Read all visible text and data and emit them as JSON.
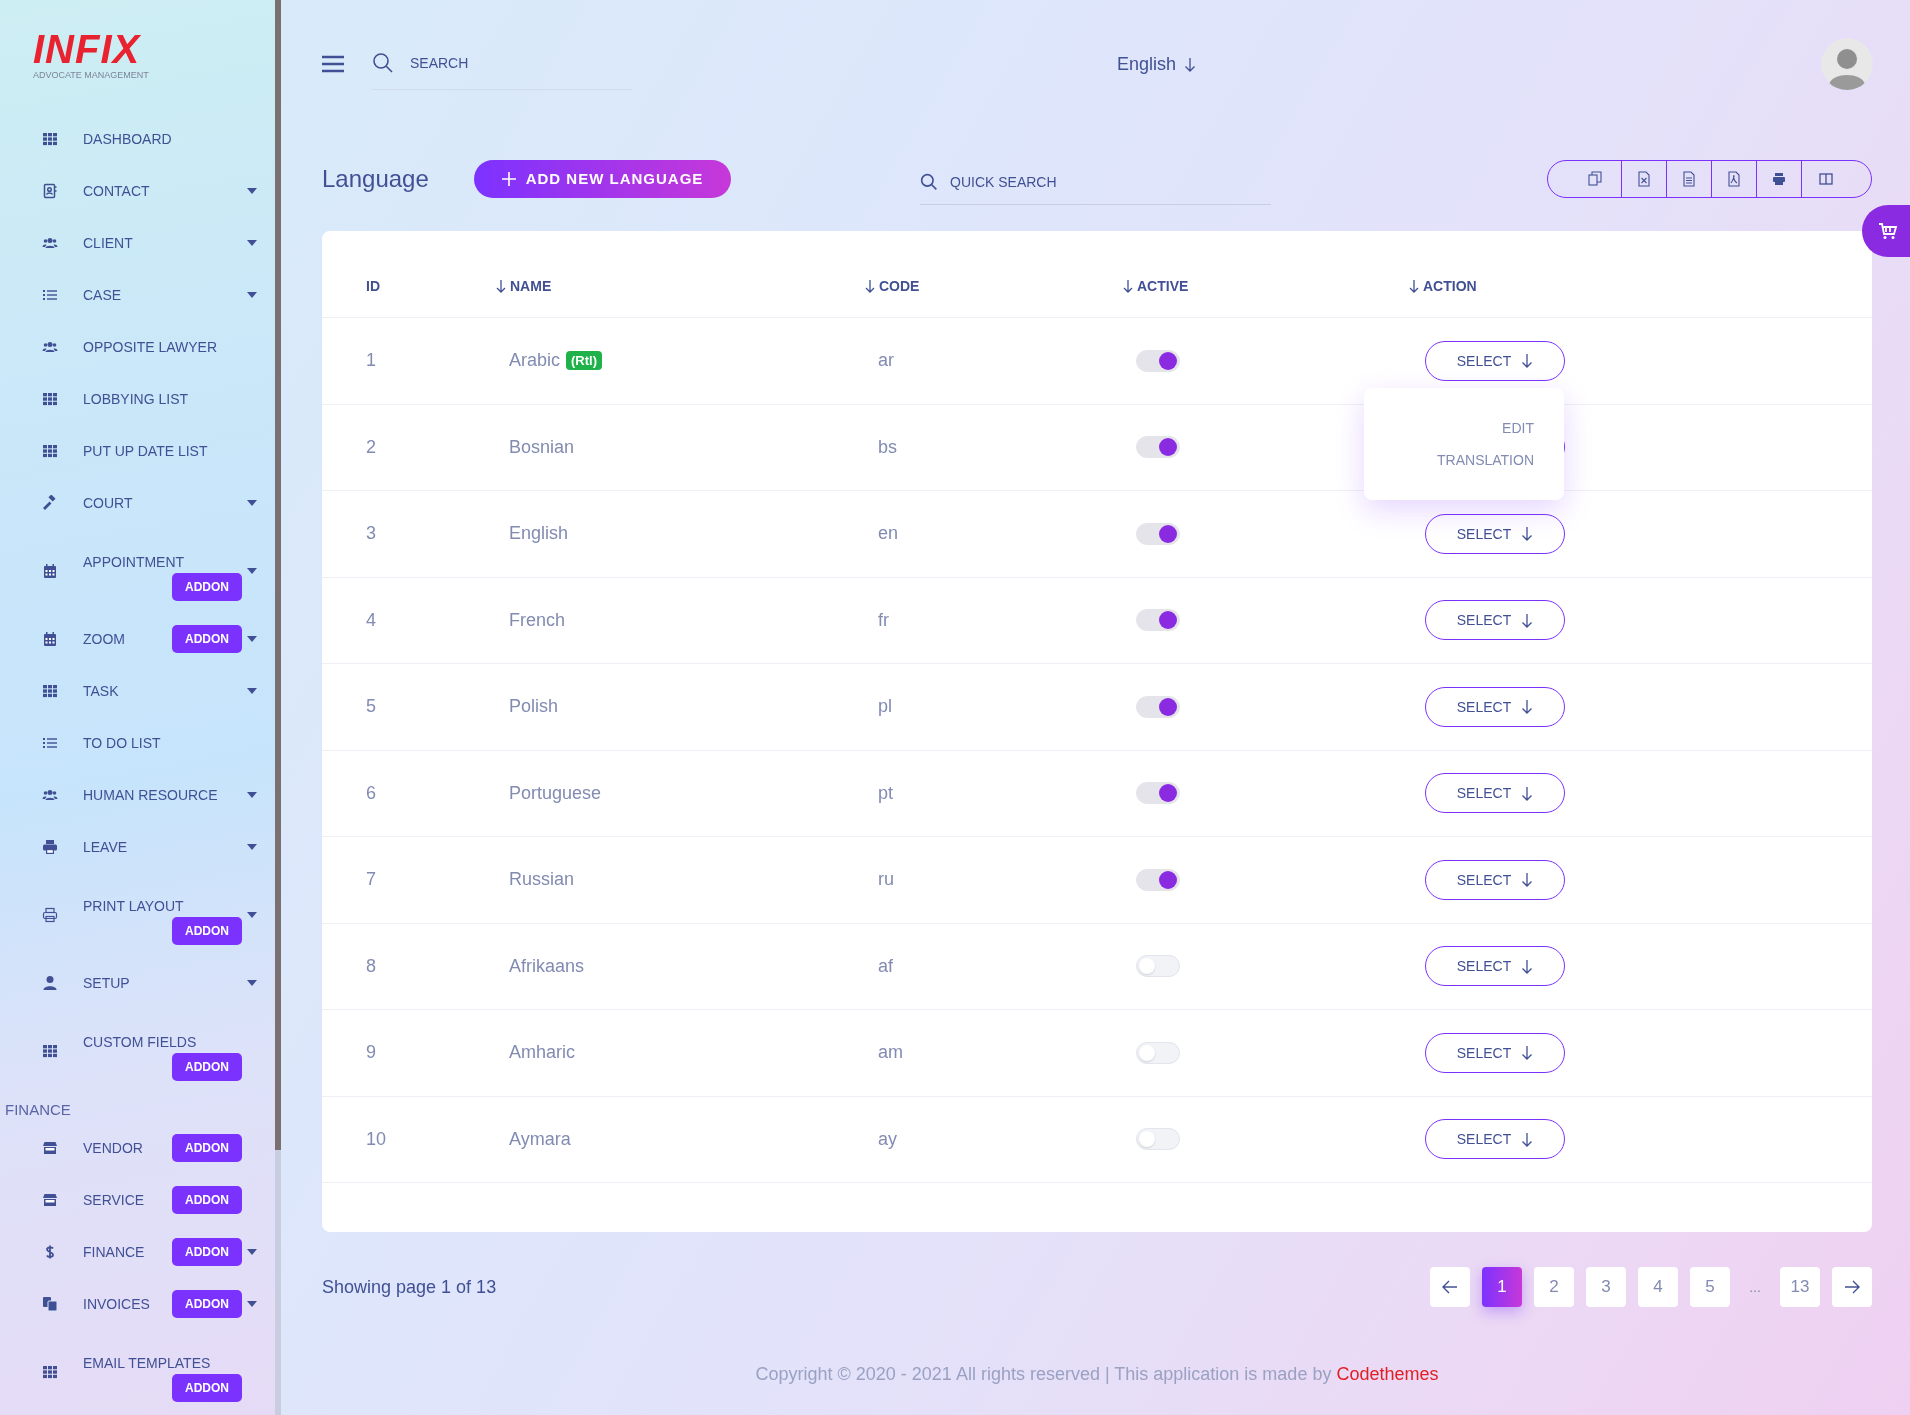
{
  "sidebar": {
    "logo": {
      "title": "INFIX",
      "subtitle": "ADVOCATE MANAGEMENT"
    },
    "sections": [
      {
        "items": [
          {
            "label": "DASHBOARD",
            "kind": "plain",
            "expandable": false
          },
          {
            "label": "CONTACT",
            "kind": "plain",
            "expandable": true
          },
          {
            "label": "CLIENT",
            "kind": "plain",
            "expandable": true
          },
          {
            "label": "CASE",
            "kind": "plain",
            "expandable": true
          },
          {
            "label": "OPPOSITE LAWYER",
            "kind": "plain",
            "expandable": false
          },
          {
            "label": "LOBBYING LIST",
            "kind": "plain",
            "expandable": false
          },
          {
            "label": "PUT UP DATE LIST",
            "kind": "plain",
            "expandable": false
          },
          {
            "label": "COURT",
            "kind": "plain",
            "expandable": true
          },
          {
            "label": "APPOINTMENT",
            "kind": "stacked",
            "addon": "ADDON",
            "expandable": true
          },
          {
            "label": "ZOOM",
            "kind": "inline",
            "addon": "ADDON",
            "expandable": true
          },
          {
            "label": "TASK",
            "kind": "plain",
            "expandable": true
          },
          {
            "label": "TO DO LIST",
            "kind": "plain",
            "expandable": false
          },
          {
            "label": "HUMAN RESOURCE",
            "kind": "plain",
            "expandable": true
          },
          {
            "label": "LEAVE",
            "kind": "plain",
            "expandable": true
          },
          {
            "label": "PRINT LAYOUT",
            "kind": "stacked",
            "addon": "ADDON",
            "expandable": true
          },
          {
            "label": "SETUP",
            "kind": "plain",
            "expandable": true
          },
          {
            "label": "CUSTOM FIELDS",
            "kind": "stacked",
            "addon": "ADDON",
            "expandable": false
          }
        ]
      },
      {
        "heading": "FINANCE",
        "items": [
          {
            "label": "VENDOR",
            "kind": "inline",
            "addon": "ADDON",
            "expandable": false
          },
          {
            "label": "SERVICE",
            "kind": "inline",
            "addon": "ADDON",
            "expandable": false
          },
          {
            "label": "FINANCE",
            "kind": "inline",
            "addon": "ADDON",
            "expandable": true
          },
          {
            "label": "INVOICES",
            "kind": "inline",
            "addon": "ADDON",
            "expandable": true
          },
          {
            "label": "EMAIL TEMPLATES",
            "kind": "stacked",
            "addon": "ADDON",
            "expandable": false
          }
        ]
      }
    ]
  },
  "header": {
    "search": {
      "placeholder": "SEARCH"
    },
    "language": "English"
  },
  "page": {
    "title": "Language",
    "add_button": "ADD NEW LANGUAGE",
    "quick_search": {
      "placeholder": "QUICK SEARCH"
    }
  },
  "table": {
    "columns": [
      {
        "label": "ID",
        "sortable": false
      },
      {
        "label": "NAME",
        "sortable": true
      },
      {
        "label": "CODE",
        "sortable": true
      },
      {
        "label": "ACTIVE",
        "sortable": true
      },
      {
        "label": "ACTION",
        "sortable": true
      }
    ],
    "rows": [
      {
        "id": "1",
        "name": "Arabic",
        "badge": "(Rtl)",
        "code": "ar",
        "active": true,
        "action": "SELECT"
      },
      {
        "id": "2",
        "name": "Bosnian",
        "code": "bs",
        "active": true
      },
      {
        "id": "3",
        "name": "English",
        "code": "en",
        "active": true,
        "action": "SELECT"
      },
      {
        "id": "4",
        "name": "French",
        "code": "fr",
        "active": true,
        "action": "SELECT"
      },
      {
        "id": "5",
        "name": "Polish",
        "code": "pl",
        "active": true,
        "action": "SELECT"
      },
      {
        "id": "6",
        "name": "Portuguese",
        "code": "pt",
        "active": true,
        "action": "SELECT"
      },
      {
        "id": "7",
        "name": "Russian",
        "code": "ru",
        "active": true,
        "action": "SELECT"
      },
      {
        "id": "8",
        "name": "Afrikaans",
        "code": "af",
        "active": false,
        "action": "SELECT"
      },
      {
        "id": "9",
        "name": "Amharic",
        "code": "am",
        "active": false,
        "action": "SELECT"
      },
      {
        "id": "10",
        "name": "Aymara",
        "code": "ay",
        "active": false,
        "action": "SELECT"
      }
    ],
    "action_menu": {
      "items": [
        "EDIT",
        "TRANSLATION"
      ]
    }
  },
  "pagination": {
    "summary": "Showing page 1 of 13",
    "pages": [
      {
        "label": "1",
        "selected": true
      },
      {
        "label": "2",
        "selected": false
      },
      {
        "label": "3",
        "selected": false
      },
      {
        "label": "4",
        "selected": false
      },
      {
        "label": "5",
        "selected": false
      },
      {
        "label": "...",
        "kind": "gap"
      },
      {
        "label": "13",
        "selected": false
      }
    ]
  },
  "footer": {
    "text": "Copyright © 2020 - 2021 All rights reserved | This application is made by",
    "link": "Codethemes"
  }
}
